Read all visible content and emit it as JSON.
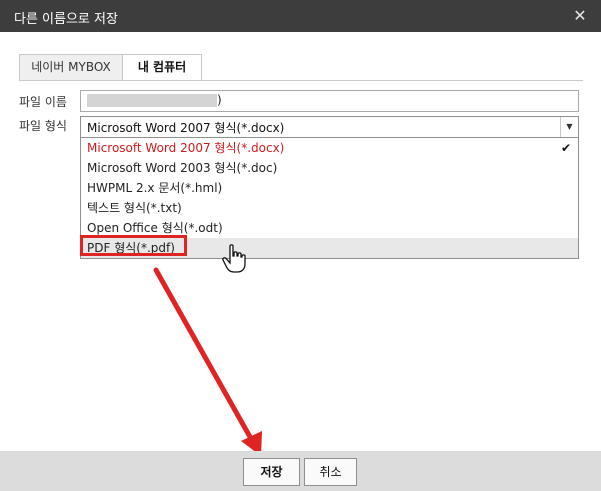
{
  "dialog": {
    "title": "다른 이름으로 저장"
  },
  "tabs": [
    {
      "label": "네이버 MYBOX"
    },
    {
      "label": "내 컴퓨터"
    }
  ],
  "form": {
    "filename_label": "파일 이름",
    "filename_suffix": ")",
    "filetype_label": "파일 형식",
    "filetype_selected": "Microsoft Word 2007 형식(*.docx)"
  },
  "options": [
    {
      "label": "Microsoft Word 2007 형식(*.docx)",
      "selected": true
    },
    {
      "label": "Microsoft Word 2003 형식(*.doc)"
    },
    {
      "label": "HWPML 2.x 문서(*.hml)"
    },
    {
      "label": "텍스트 형식(*.txt)"
    },
    {
      "label": "Open Office 형식(*.odt)"
    },
    {
      "label": "PDF 형식(*.pdf)",
      "hovered": true
    }
  ],
  "buttons": {
    "save": "저장",
    "cancel": "취소"
  },
  "icons": {
    "close": "close-icon",
    "dropdown": "chevron-down-icon",
    "check": "check-icon",
    "cursor": "hand-pointer-icon"
  },
  "colors": {
    "titlebar": "#3d3d3d",
    "selected_option": "#d11b1b",
    "annotation": "#e02323",
    "footer": "#dcdcdc"
  }
}
